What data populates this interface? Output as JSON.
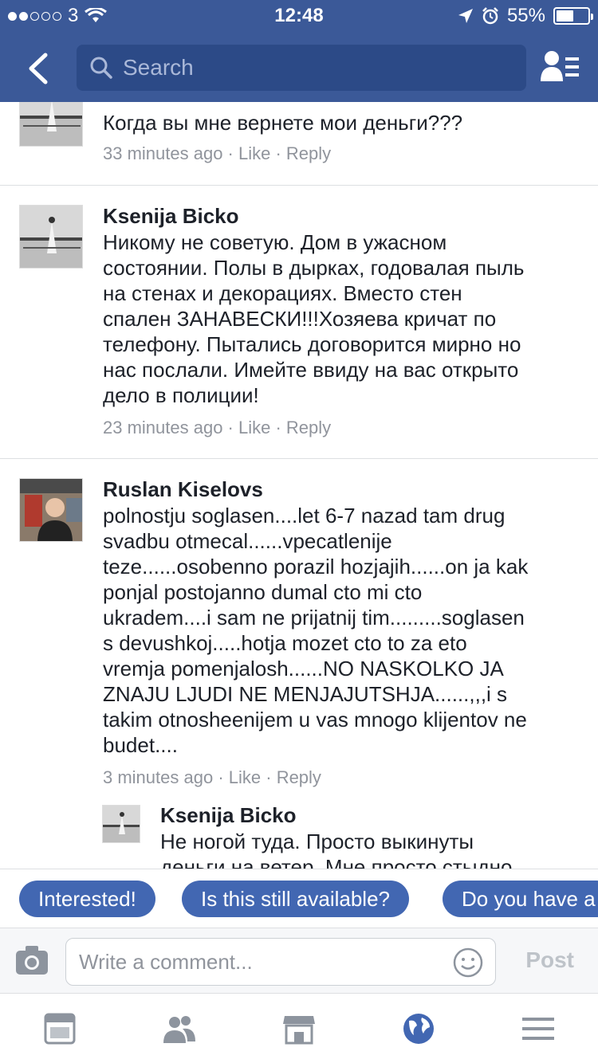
{
  "status": {
    "carrier": "3",
    "time": "12:48",
    "battery": "55%",
    "battery_level": 0.55
  },
  "nav": {
    "search_placeholder": "Search"
  },
  "comments": [
    {
      "author": "",
      "text": "Когда вы мне вернете мои деньги???",
      "time": "33 minutes ago",
      "like": "Like",
      "reply": "Reply"
    },
    {
      "author": "Ksenija Bicko",
      "text": "Никому не советую. Дом в ужасном\nсостоянии. Полы в дырках, годовалая пыль\nна стенах и декорациях. Вместо стен\nспален ЗАНАВЕСКИ!!!Хозяева кричат по\nтелефону. Пытались договорится мирно но\nнас послали. Имейте ввиду на вас открыто\nдело в полиции!",
      "time": "23 minutes ago",
      "like": "Like",
      "reply": "Reply"
    },
    {
      "author": "Ruslan Kiselovs",
      "text": "polnostju soglasen....let 6-7 nazad tam drug\nsvadbu otmecal......vpecatlenije\nteze......osobenno porazil hozjajih......on ja kak\nponjal postojanno dumal cto mi cto\nukradem....i sam ne prijatnij tim.........soglasen\ns devushkoj.....hotja mozet cto to za eto\nvremja pomenjalosh......NO NASKOLKO JA\nZNAJU LJUDI NE MENJAJUTSHJA......,,,i s\ntakim otnosheenijem u vas mnogo klijentov ne\nbudet....",
      "time": "3 minutes ago",
      "like": "Like",
      "reply": "Reply"
    },
    {
      "author": "Ksenija Bicko",
      "text": "Не ногой туда. Просто выкинуты\nденьги на ветер. Мне просто стыдно"
    }
  ],
  "quick_replies": [
    "Interested!",
    "Is this still available?",
    "Do you have a"
  ],
  "compose": {
    "placeholder": "Write a comment...",
    "post_label": "Post"
  },
  "colors": {
    "brand": "#3b5998",
    "chip": "#4267b2",
    "active_tab": "#4267b2"
  }
}
